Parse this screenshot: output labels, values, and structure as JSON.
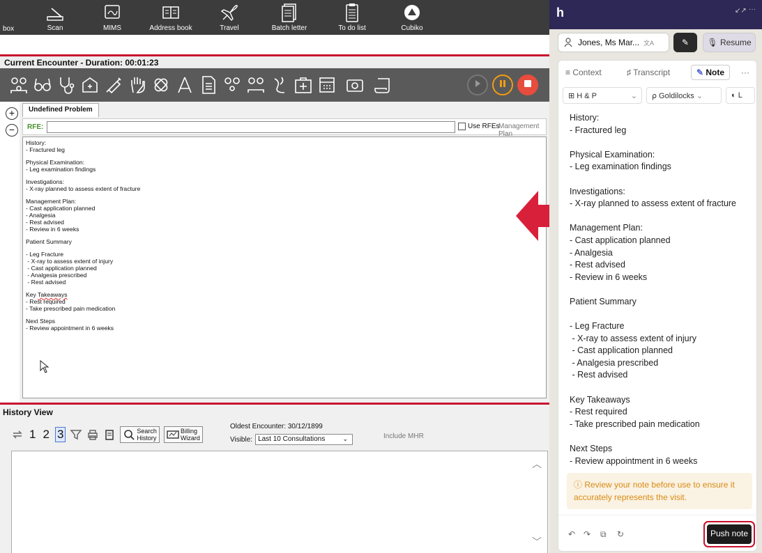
{
  "toolbar": {
    "partial_label": "box",
    "items": [
      {
        "label": "Scan",
        "icon": "scan-icon"
      },
      {
        "label": "MIMS",
        "icon": "mims-icon"
      },
      {
        "label": "Address book",
        "icon": "address-book-icon"
      },
      {
        "label": "Travel",
        "icon": "plane-icon"
      },
      {
        "label": "Batch letter",
        "icon": "batch-letter-icon"
      },
      {
        "label": "To do list",
        "icon": "clipboard-icon"
      },
      {
        "label": "Cubiko",
        "icon": "cubiko-icon"
      }
    ]
  },
  "encounter": {
    "title": "Current Encounter - Duration: 00:01:23",
    "tab_label": "Undefined Problem",
    "rfe_label": "RFE:",
    "rfe_value": "",
    "use_rfes_label": "Use RFEs",
    "management_plan_label": "Management Plan",
    "note_lines": [
      "History:",
      "- Fractured leg",
      "",
      "Physical Examination:",
      "- Leg examination findings",
      "",
      "Investigations:",
      "- X-ray planned to assess extent of fracture",
      "",
      "Management Plan:",
      "- Cast application planned",
      "- Analgesia",
      "- Rest advised",
      "- Review in 6 weeks",
      "",
      "Patient Summary",
      "",
      "- Leg Fracture",
      " - X-ray to assess extent of injury",
      " - Cast application planned",
      " - Analgesia prescribed",
      " - Rest advised",
      "",
      "Key Takeaways",
      "- Rest required",
      "- Take prescribed pain medication",
      "",
      "Next Steps",
      "- Review appointment in 6 weeks"
    ]
  },
  "history": {
    "title": "History View",
    "page_numbers": [
      "1",
      "2",
      "3"
    ],
    "active_page": "3",
    "search_history_label": "Search\nHistory",
    "billing_wizard_label": "Billing\nWizard",
    "oldest_encounter": "Oldest Encounter: 30/12/1899",
    "visible_label": "Visible:",
    "visible_value": "Last 10 Consultations",
    "include_mhr": "Include MHR"
  },
  "right_panel": {
    "logo": "h",
    "patient_name": "Jones, Ms Mar...",
    "resume_label": "Resume",
    "tabs": {
      "context": "Context",
      "transcript": "Transcript",
      "note": "Note",
      "more": "···"
    },
    "template": "H & P",
    "style": "Goldilocks",
    "theme": "L",
    "note_lines": [
      "History:",
      "- Fractured leg",
      "",
      "Physical Examination:",
      "- Leg examination findings",
      "",
      "Investigations:",
      "- X-ray planned to assess extent of fracture",
      "",
      "Management Plan:",
      "- Cast application planned",
      "- Analgesia",
      "- Rest advised",
      "- Review in 6 weeks",
      "",
      "Patient Summary",
      "",
      "- Leg Fracture",
      " - X-ray to assess extent of injury",
      " - Cast application planned",
      " - Analgesia prescribed",
      " - Rest advised",
      "",
      "Key Takeaways",
      "- Rest required",
      "- Take prescribed pain medication",
      "",
      "Next Steps",
      "- Review appointment in 6 weeks"
    ],
    "warning": "Review your note before use to ensure it accurately represents the visit.",
    "push_note_label": "Push note",
    "warning_color": "#d88b14",
    "push_highlight_color": "#c8102e"
  }
}
